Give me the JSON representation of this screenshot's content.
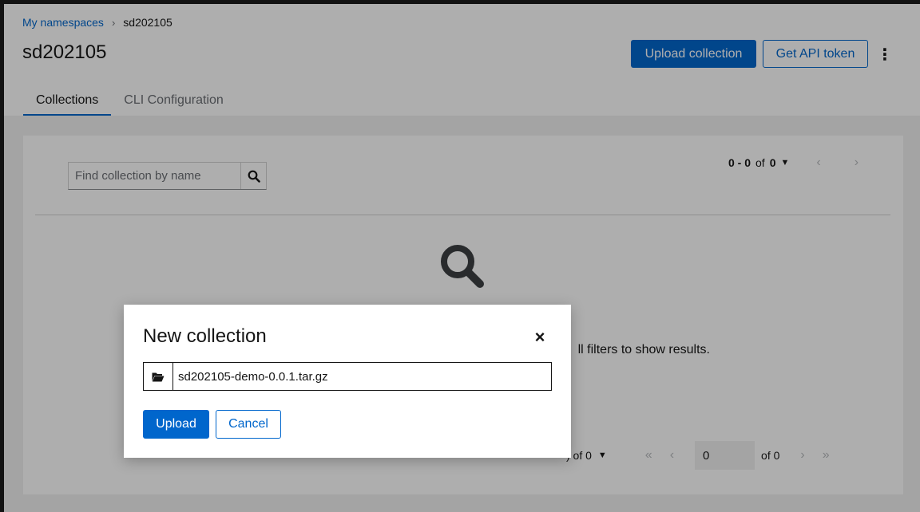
{
  "breadcrumb": {
    "root": "My namespaces",
    "current": "sd202105"
  },
  "page": {
    "title": "sd202105"
  },
  "toolbar": {
    "upload_label": "Upload collection",
    "api_token_label": "Get API token",
    "kebab_icon": "kebab-icon"
  },
  "tabs": [
    {
      "label": "Collections",
      "active": true
    },
    {
      "label": "CLI Configuration",
      "active": false
    }
  ],
  "search": {
    "placeholder": "Find collection by name",
    "icon": "search-icon"
  },
  "pager_top": {
    "range": "0 - 0",
    "of_word": "of",
    "total": "0"
  },
  "empty_state": {
    "icon": "search-icon",
    "text_visible": "ll filters to show results."
  },
  "pager_bottom": {
    "range_partial": ") of 0",
    "page_value": "0",
    "of_pages": "of 0"
  },
  "modal": {
    "title": "New collection",
    "close_icon": "close-icon",
    "file_icon": "folder-open-icon",
    "file_value": "sd202105-demo-0.0.1.tar.gz",
    "upload_label": "Upload",
    "cancel_label": "Cancel"
  },
  "colors": {
    "primary": "#0066cc",
    "overlay": "rgba(3,3,3,0.32)"
  }
}
